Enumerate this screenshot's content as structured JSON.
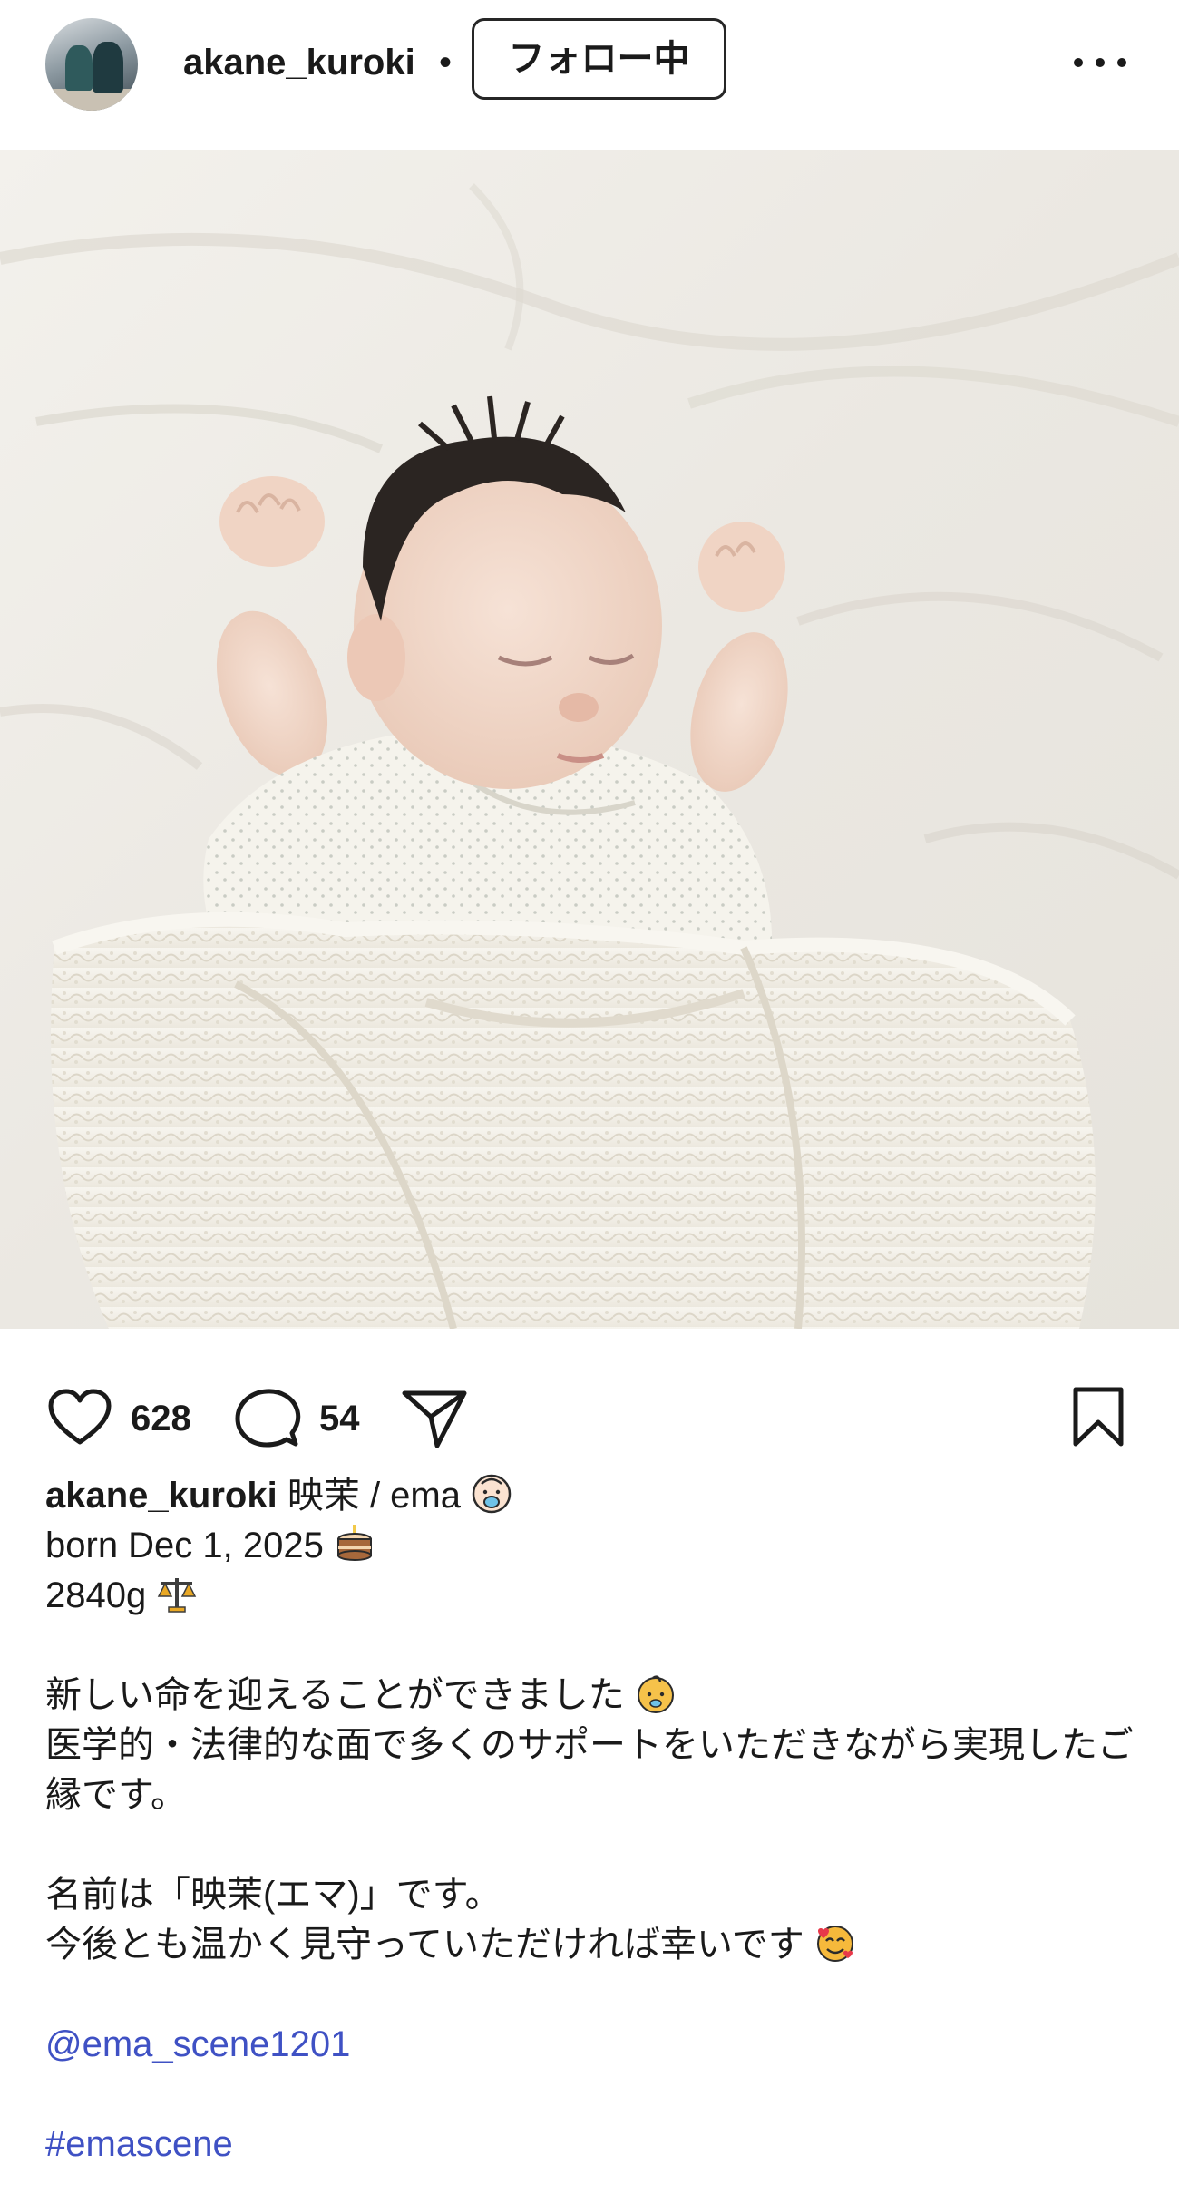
{
  "post_header": {
    "username": "akane_kuroki",
    "separator": "•",
    "follow_label": "フォロー中"
  },
  "post_actions": {
    "likes": "628",
    "comments": "54"
  },
  "caption": {
    "username": "akane_kuroki",
    "line1": "映茉 / ema",
    "line2": "born Dec 1, 2025",
    "line3": "2840g",
    "para1_line1": "新しい命を迎えることができました",
    "para1_line2": "医学的・法律的な面で多くのサポートをいただきながら実現したご縁です。",
    "para2_line1": "名前は「映茉(エマ)」です。",
    "para2_line2": "今後とも温かく見守っていただければ幸いです",
    "mention": "@ema_scene1201",
    "hashtag": "#emascene"
  },
  "icons": {
    "avatar": "profile-photo",
    "more": "more-horizontal-icon",
    "tag": "user-tag-icon",
    "like": "heart-icon",
    "comment": "comment-bubble-icon",
    "share": "paper-plane-icon",
    "save": "bookmark-icon",
    "emoji1": "baby-with-pacifier-emoji",
    "emoji2": "birthday-cake-emoji",
    "emoji3": "balance-scale-emoji",
    "emoji4": "baby-face-emoji",
    "emoji5": "smiling-face-with-hearts-emoji"
  },
  "colors": {
    "text": "#1a1a1a",
    "link": "#3f51c4",
    "background": "#ffffff"
  }
}
